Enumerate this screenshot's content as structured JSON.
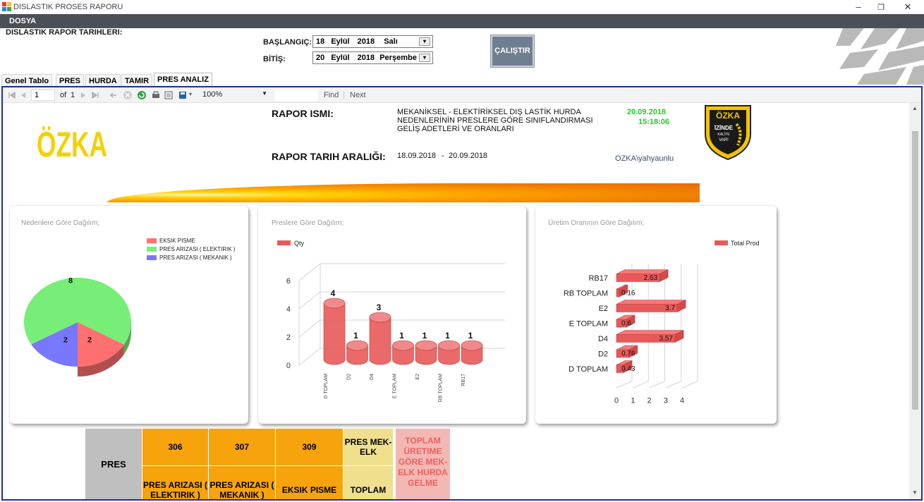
{
  "window": {
    "title": "DISLASTIK PROSES RAPORU"
  },
  "menu": {
    "items": [
      "DOSYA"
    ]
  },
  "filter": {
    "section_label": "DISLASTIK RAPOR TARIHLERI:",
    "start_label": "BAŞLANGIÇ:",
    "end_label": "BİTİŞ:",
    "start_date": {
      "day": "18",
      "month": "Eylül",
      "year": "2018",
      "weekday": "Salı"
    },
    "end_date": {
      "day": "20",
      "month": "Eylül",
      "year": "2018",
      "weekday": "Perşembe"
    },
    "run_label": "ÇALIŞTIR"
  },
  "tabs": [
    "Genel Tablo",
    "PRES",
    "HURDA",
    "TAMIR",
    "PRES ANALIZ"
  ],
  "active_tab": "PRES ANALIZ",
  "toolbar": {
    "page_value": "1",
    "of_label": "of",
    "page_count": "1",
    "zoom": "100%",
    "find_label": "Find",
    "next_label": "Next"
  },
  "report": {
    "logo_text": "ÖZKA",
    "badge_text": {
      "top": "ÖZKA",
      "line1": "İZİNDE",
      "line2": "KALİTE",
      "line3": "VAR!"
    },
    "name_label": "RAPOR ISMI:",
    "name_lines": [
      "MEKANİKSEL - ELEKTİRİKSEL DIŞ LASTİK HURDA",
      "NEDENLERİNİN PRESLERE GÖRE SINIFLANDIRMASI",
      "GELİŞ ADETLERİ VE ORANLARI"
    ],
    "print_date": "20.09.2018",
    "print_time": "15:18:06",
    "range_label": "RAPOR TARIH ARALIĞI:",
    "range_start": "18.09.2018",
    "range_sep": "-",
    "range_end": "20.09.2018",
    "user": "OZKA\\yahyaunlu",
    "colors": {
      "green_text": "#22cc22",
      "accent": "#f4a000",
      "logo": "#f5d000",
      "frame": "#1b2ea8"
    }
  },
  "chart_data": [
    {
      "type": "pie",
      "title": "Nedenlere Göre Dağılım;",
      "categories": [
        "EKSIK PISME",
        "PRES ARIZASI ( ELEKTIRIK )",
        "PRES ARIZASI ( MEKANIK )"
      ],
      "values": [
        2,
        8,
        2
      ],
      "colors": [
        "#ff7070",
        "#77ee77",
        "#7777ff"
      ],
      "legend": "top-right"
    },
    {
      "type": "bar",
      "title": "Preslere Göre Dağılım;",
      "categories": [
        "D TOPLAM",
        "D2",
        "D4",
        "E TOPLAM",
        "E2",
        "RB TOPLAM",
        "RB17"
      ],
      "series": [
        {
          "name": "Qty",
          "values": [
            4,
            1,
            3,
            1,
            1,
            1,
            1
          ]
        }
      ],
      "yticks": [
        "0",
        "2",
        "4",
        "6"
      ],
      "ylim": [
        0,
        6
      ],
      "colors": [
        "#e85a5a"
      ],
      "legend": "top-left"
    },
    {
      "type": "bar",
      "orientation": "horizontal",
      "title": "Üretim Oranının Göre Dağılım;",
      "categories": [
        "RB17",
        "RB TOPLAM",
        "E2",
        "E TOPLAM",
        "D4",
        "D2",
        "D TOPLAM"
      ],
      "series": [
        {
          "name": "Total Prod",
          "values": [
            2.63,
            0.16,
            3.7,
            0.6,
            3.57,
            0.76,
            0.43
          ]
        }
      ],
      "xticks": [
        "0",
        "1",
        "2",
        "3",
        "4"
      ],
      "xlim": [
        0,
        4
      ],
      "colors": [
        "#e85a5a"
      ],
      "legend": "top-right"
    }
  ],
  "bottom_table": {
    "row_header": "PRES",
    "columns": [
      {
        "top": "306",
        "bottom": "PRES ARIZASI ( ELEKTIRIK )"
      },
      {
        "top": "307",
        "bottom": "PRES ARIZASI ( MEKANIK )"
      },
      {
        "top": "309",
        "bottom": "EKSIK PISME"
      },
      {
        "top": "PRES MEK-ELK",
        "bottom": "TOPLAM"
      }
    ],
    "right_header": "TOPLAM ÜRETIME GÖRE MEK-ELK HURDA GELME"
  }
}
